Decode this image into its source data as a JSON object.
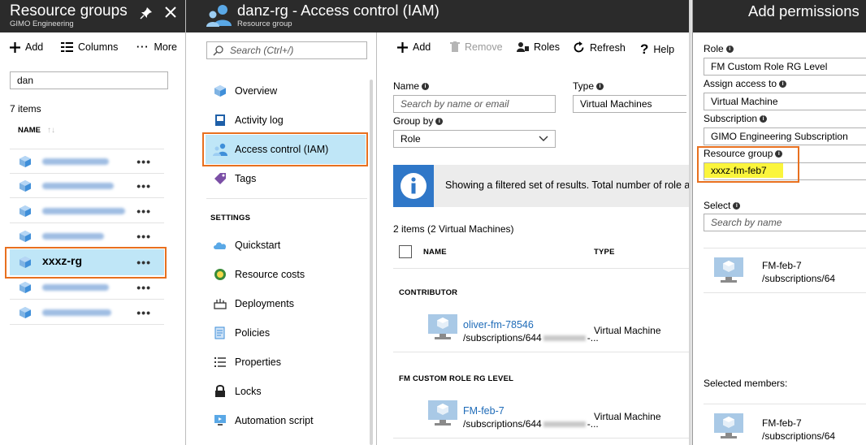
{
  "blade1": {
    "title": "Resource groups",
    "subtitle": "GIMO Engineering",
    "pin_icon": "pin-icon",
    "close_icon": "close-icon",
    "toolbar": {
      "add": "Add",
      "columns": "Columns",
      "more": "More"
    },
    "filter_value": "dan",
    "count": "7 items",
    "column_name": "NAME",
    "selected_item": "xxxz-rg"
  },
  "blade2": {
    "title": "danz-rg - Access control (IAM)",
    "subtitle": "Resource group",
    "search_placeholder": "Search (Ctrl+/)",
    "nav": {
      "overview": "Overview",
      "activity_log": "Activity log",
      "access_control": "Access control (IAM)",
      "tags": "Tags"
    },
    "settings_header": "SETTINGS",
    "settings": {
      "quickstart": "Quickstart",
      "resource_costs": "Resource costs",
      "deployments": "Deployments",
      "policies": "Policies",
      "properties": "Properties",
      "locks": "Locks",
      "automation_script": "Automation script"
    }
  },
  "blade3": {
    "toolbar": {
      "add": "Add",
      "remove": "Remove",
      "roles": "Roles",
      "refresh": "Refresh",
      "help": "Help"
    },
    "name_label": "Name",
    "name_placeholder": "Search by name or email",
    "type_label": "Type",
    "type_value": "Virtual Machines",
    "group_label": "Group by",
    "group_value": "Role",
    "banner": "Showing a filtered set of results. Total number of role ass",
    "count": "2 items (2 Virtual Machines)",
    "col_name": "NAME",
    "col_type": "TYPE",
    "group1": "CONTRIBUTOR",
    "row1": {
      "name": "oliver-fm-78546",
      "path": "/subscriptions/644",
      "path_tail": "-...",
      "type": "Virtual Machine"
    },
    "group2": "FM CUSTOM ROLE RG LEVEL",
    "row2": {
      "name": "FM-feb-7",
      "path": "/subscriptions/644",
      "path_tail": "-...",
      "type": "Virtual Machine"
    }
  },
  "blade4": {
    "title": "Add permissions",
    "role_label": "Role",
    "role_value": "FM Custom Role RG Level",
    "assign_label": "Assign access to",
    "assign_value": "Virtual Machine",
    "subscription_label": "Subscription",
    "subscription_value": "GIMO Engineering Subscription",
    "rg_label": "Resource group",
    "rg_value": "xxxz-fm-feb7",
    "select_label": "Select",
    "select_placeholder": "Search by name",
    "result": {
      "name": "FM-feb-7",
      "path": "/subscriptions/64"
    },
    "selected_label": "Selected members:",
    "selected": {
      "name": "FM-feb-7",
      "path": "/subscriptions/64"
    }
  }
}
